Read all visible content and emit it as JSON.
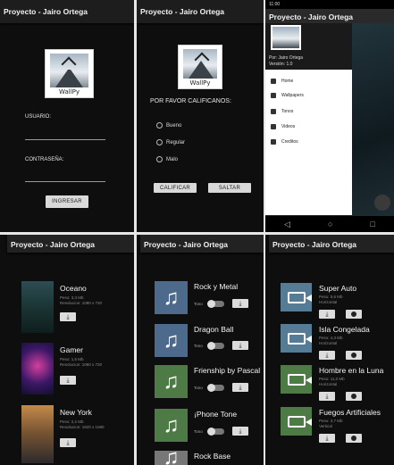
{
  "colors": {
    "music_blue": "#4d6a8c",
    "music_green": "#4e7a46",
    "video_blue": "#557c94",
    "video_green": "#4e7a46"
  },
  "login": {
    "title": "Proyecto - Jairo Ortega",
    "logo_caption": "WallPy",
    "usuario_label": "USUARIO:",
    "contrasena_label": "CONTRASEÑA:",
    "ingresar": "INGRESAR"
  },
  "rating": {
    "title": "Proyecto - Jairo Ortega",
    "logo_caption": "WallPy",
    "prompt": "POR FAVOR CALIFICANOS:",
    "options": [
      "Bueno",
      "Regular",
      "Malo"
    ],
    "calificar": "CALIFICAR",
    "saltar": "SALTAR"
  },
  "drawer": {
    "time": "11:00",
    "title": "Proyecto - Jairo Ortega",
    "author": "Por: Jairo Ortega",
    "version": "Versión: 1.0",
    "items": [
      "Home",
      "Wallpapers",
      "Tonos",
      "Videos",
      "Creditos"
    ],
    "icons": [
      "home-icon",
      "image-icon",
      "music-icon",
      "video-icon",
      "credits-icon"
    ],
    "nav": [
      "◁",
      "○",
      "□"
    ]
  },
  "wallpapers": {
    "title": "Proyecto - Jairo Ortega",
    "items": [
      {
        "name": "Oceano",
        "peso": "Peso: 3,3 Mb",
        "res": "Resolucion: 1080 x 720"
      },
      {
        "name": "Gamer",
        "peso": "Peso: 1,6 Mb",
        "res": "Resolucion: 1080 x 720"
      },
      {
        "name": "New York",
        "peso": "Peso: 2,2 Mb",
        "res": "Resolucion: 1920 x 1080"
      }
    ]
  },
  "tonos": {
    "title": "Proyecto - Jairo Ortega",
    "toggle_label": "Tono",
    "items": [
      "Rock y Metal",
      "Dragon Ball",
      "Frienship by Pascal",
      "¡Phone Tone",
      "Rock Base"
    ]
  },
  "videos": {
    "title": "Proyecto - Jairo Ortega",
    "items": [
      {
        "name": "Super Auto",
        "peso": "Peso: 5,6 Mb",
        "orient": "Horizontal"
      },
      {
        "name": "Isla Congelada",
        "peso": "Peso: 4,3 Mb",
        "orient": "Horizontal"
      },
      {
        "name": "Hombre en la Luna",
        "peso": "Peso: 11,0 Mb",
        "orient": "Horizontal"
      },
      {
        "name": "Fuegos Artificiales",
        "peso": "Peso: 3,7 Mb",
        "orient": "Vertical"
      }
    ]
  }
}
